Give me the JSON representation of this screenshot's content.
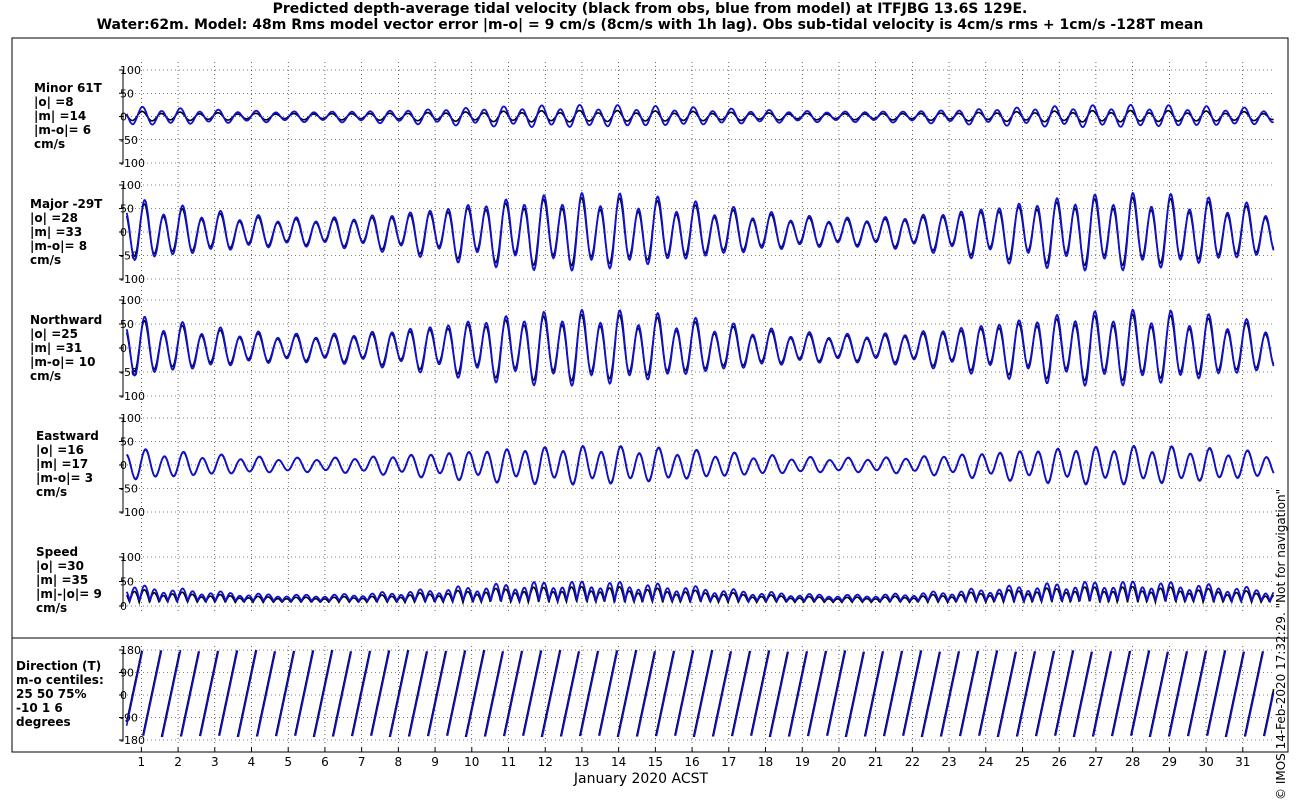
{
  "header": {
    "title_line1": "Predicted depth-average tidal velocity (black from obs, blue from model) at ITFJBG 13.6S 129E.",
    "title_line2": "Water:62m. Model: 48m  Rms model vector error |m-o| = 9 cm/s (8cm/s with 1h lag). Obs sub-tidal velocity is 4cm/s rms + 1cm/s -128T mean"
  },
  "footer": {
    "side_text": "© IMOS 14-Feb-2020 17:32:29.  \"Not for navigation\""
  },
  "colors": {
    "obs": "#000000",
    "model": "#1010d0",
    "grid": "#000000"
  },
  "chart_data": {
    "type": "line",
    "x_axis": {
      "label": "January 2020 ACST",
      "ticks": [
        "1",
        "2",
        "3",
        "4",
        "5",
        "6",
        "7",
        "8",
        "9",
        "10",
        "11",
        "12",
        "13",
        "14",
        "15",
        "16",
        "17",
        "18",
        "19",
        "20",
        "21",
        "22",
        "23",
        "24",
        "25",
        "26",
        "27",
        "28",
        "29",
        "30",
        "31"
      ],
      "range_days": [
        0.5,
        31.85
      ]
    },
    "legend_words": {
      "obs": "black from obs",
      "model": "blue from model"
    },
    "panels": [
      {
        "id": "minor",
        "labels": [
          "Minor 61T",
          "|o| =8",
          "|m| =14",
          "|m-o|= 6",
          "cm/s"
        ],
        "ylim": [
          -100,
          100
        ],
        "yticks": [
          100,
          50,
          0,
          -50,
          -100
        ],
        "ytick_labels": [
          "100",
          "50",
          "0",
          "-50",
          "-100"
        ],
        "model": {
          "amp": 15,
          "mod": 0.35,
          "offset": 0,
          "phase": 1.6
        },
        "obs": {
          "amp": 8,
          "mod": 0.3,
          "offset": 0,
          "phase": 1.7
        }
      },
      {
        "id": "major",
        "labels": [
          "Major -29T",
          "|o| =28",
          "|m| =33",
          "|m-o|= 8",
          "cm/s"
        ],
        "ylim": [
          -100,
          100
        ],
        "yticks": [
          100,
          50,
          0,
          -50,
          -100
        ],
        "ytick_labels": [
          "100",
          "50",
          "0",
          "-50",
          "-100"
        ],
        "model": {
          "amp": 48,
          "mod": 0.45,
          "offset": 0,
          "phase": 0.9
        },
        "obs": {
          "amp": 42,
          "mod": 0.45,
          "offset": 0,
          "phase": 1.0
        }
      },
      {
        "id": "northward",
        "labels": [
          "Northward",
          "|o| =25",
          "|m| =31",
          "|m-o|= 10",
          "cm/s"
        ],
        "ylim": [
          -100,
          100
        ],
        "yticks": [
          100,
          50,
          0,
          -50,
          -100
        ],
        "ytick_labels": [
          "100",
          "50",
          "0",
          "-50",
          "-100"
        ],
        "model": {
          "amp": 46,
          "mod": 0.45,
          "offset": 0,
          "phase": 0.9
        },
        "obs": {
          "amp": 40,
          "mod": 0.45,
          "offset": 0,
          "phase": 1.0
        }
      },
      {
        "id": "eastward",
        "labels": [
          "Eastward",
          "|o| =16",
          "|m| =17",
          "|m-o|= 3",
          "cm/s"
        ],
        "ylim": [
          -100,
          100
        ],
        "yticks": [
          100,
          50,
          0,
          -50,
          -100
        ],
        "ytick_labels": [
          "100",
          "50",
          "0",
          "-50",
          "-100"
        ],
        "model": {
          "amp": 24,
          "mod": 0.45,
          "offset": 0,
          "phase": 0.6
        },
        "obs": {
          "amp": 23,
          "mod": 0.45,
          "offset": 0,
          "phase": 0.65
        }
      },
      {
        "id": "speed",
        "labels": [
          "Speed",
          "|o| =30",
          "|m| =35",
          "|m|-|o|= 9",
          "cm/s"
        ],
        "ylim": [
          0,
          100
        ],
        "yticks": [
          100,
          50,
          0
        ],
        "ytick_labels": [
          "100",
          "50",
          "0"
        ],
        "model": {
          "amp": 25,
          "mod": 0.5,
          "offset": 32,
          "phase": 0.9
        },
        "obs": {
          "amp": 20,
          "mod": 0.5,
          "offset": 24,
          "phase": 1.0
        }
      },
      {
        "id": "direction",
        "labels": [
          "Direction (T)",
          "m-o centiles:",
          "25  50  75%",
          "-10   1   6",
          "degrees"
        ],
        "ylim": [
          -180,
          180
        ],
        "yticks": [
          180,
          90,
          0,
          -90,
          -180
        ],
        "ytick_labels": [
          "180",
          "90",
          "0",
          "-90",
          "-180"
        ]
      }
    ],
    "tide_period_hours": 12.42,
    "spring_neap_days": 14.77
  }
}
